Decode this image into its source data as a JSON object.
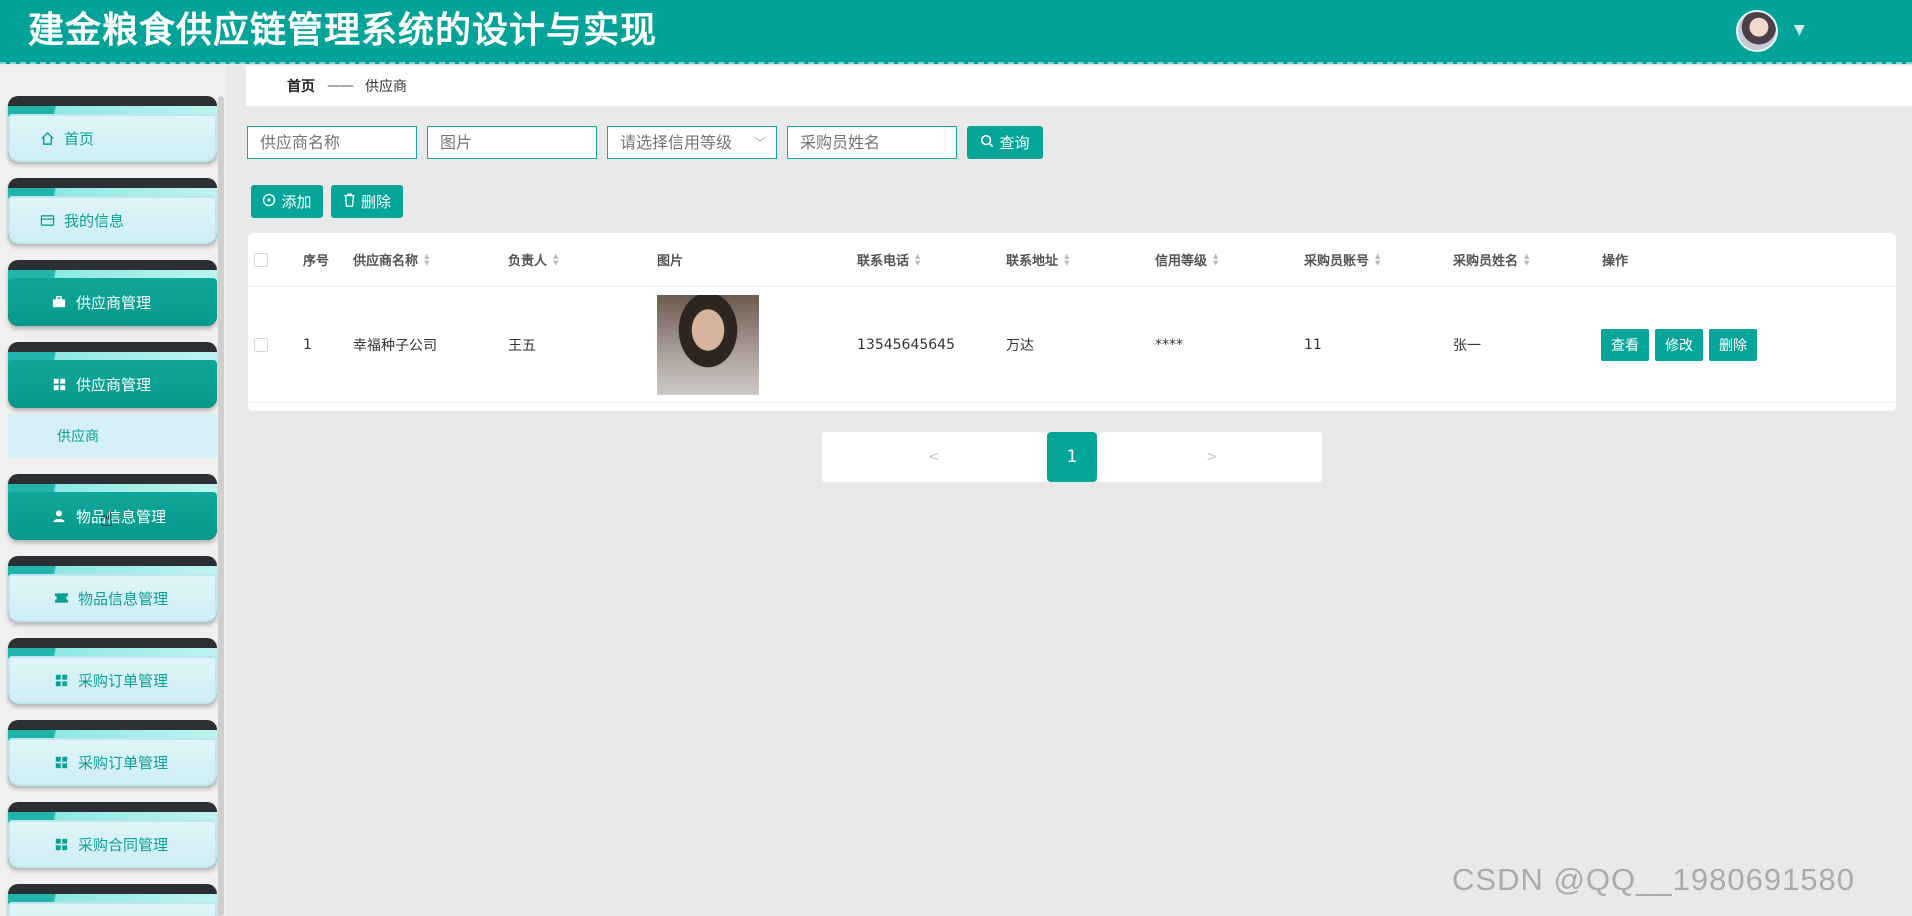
{
  "header": {
    "title": "建金粮食供应链管理系统的设计与实现",
    "avatar_icon": "user-avatar",
    "caret": "▼"
  },
  "sidebar": {
    "items": [
      {
        "label": "首页",
        "icon": "home-icon",
        "style": "light"
      },
      {
        "label": "我的信息",
        "icon": "card-icon",
        "style": "light"
      },
      {
        "label": "供应商管理",
        "icon": "briefcase-icon",
        "style": "dark"
      },
      {
        "label": "供应商管理",
        "icon": "grid-icon",
        "style": "dark"
      },
      {
        "label": "物品信息管理",
        "icon": "user-icon",
        "style": "dark"
      },
      {
        "label": "物品信息管理",
        "icon": "ticket-icon",
        "style": "light"
      },
      {
        "label": "采购订单管理",
        "icon": "grid-icon",
        "style": "light"
      },
      {
        "label": "采购订单管理",
        "icon": "grid-icon",
        "style": "light"
      },
      {
        "label": "采购合同管理",
        "icon": "grid-icon",
        "style": "light"
      }
    ],
    "submenu": {
      "label": "供应商"
    }
  },
  "breadcrumb": {
    "home": "首页",
    "separator": "——",
    "current": "供应商"
  },
  "search": {
    "supplier_name_placeholder": "供应商名称",
    "image_placeholder": "图片",
    "credit_placeholder": "请选择信用等级",
    "buyer_name_placeholder": "采购员姓名",
    "query_label": "查询"
  },
  "actions": {
    "add_label": "添加",
    "delete_label": "删除"
  },
  "table": {
    "columns": [
      "序号",
      "供应商名称",
      "负责人",
      "图片",
      "联系电话",
      "联系地址",
      "信用等级",
      "采购员账号",
      "采购员姓名",
      "操作"
    ],
    "rows": [
      {
        "index": "1",
        "supplier_name": "幸福种子公司",
        "manager": "王五",
        "phone": "13545645645",
        "address": "万达",
        "credit": "****",
        "buyer_account": "11",
        "buyer_name": "张一",
        "ops": {
          "view": "查看",
          "edit": "修改",
          "delete": "删除"
        }
      }
    ]
  },
  "pagination": {
    "prev": "<",
    "current": "1",
    "next": ">"
  },
  "watermark": "CSDN @QQ__1980691580",
  "colors": {
    "primary": "#06a599",
    "header_bg": "#03a39a",
    "sidebar_light": "#dff5f8",
    "sidebar_dark": "#0fa799"
  }
}
